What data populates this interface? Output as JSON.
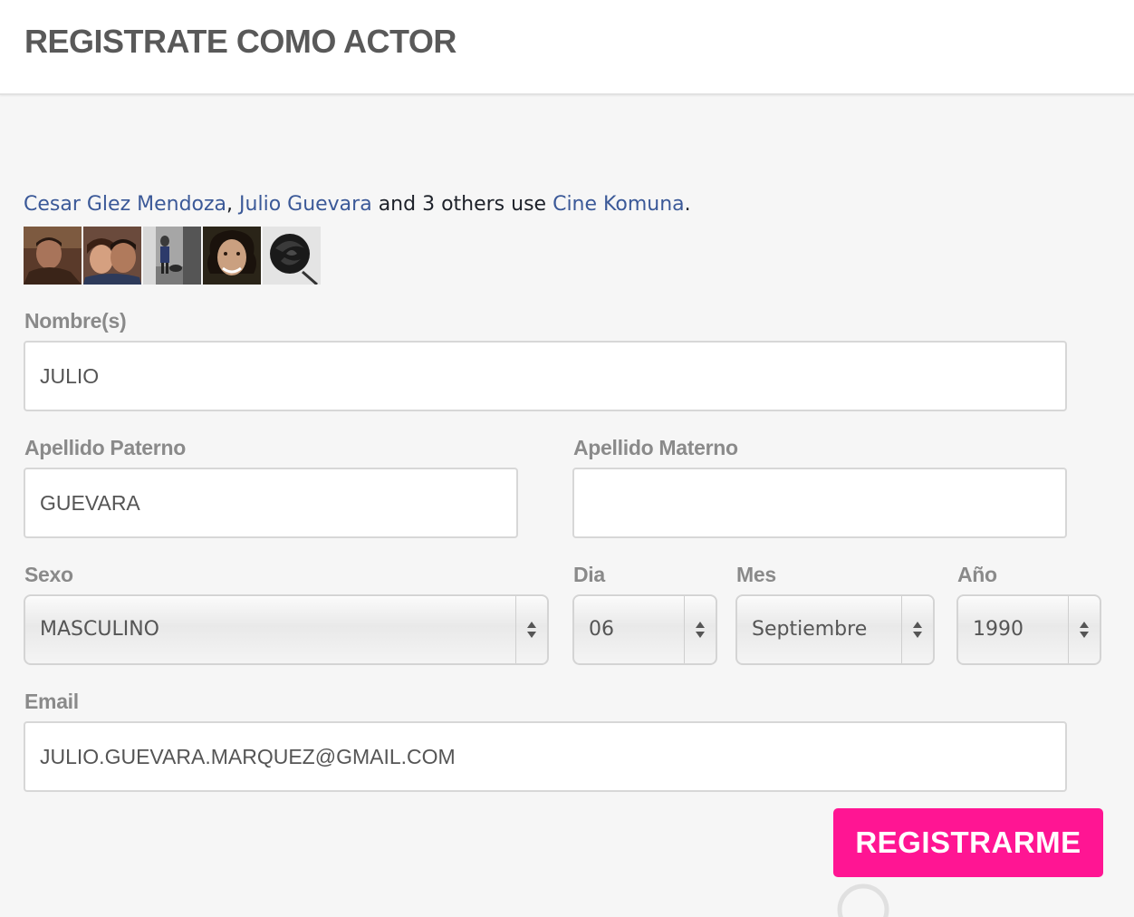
{
  "header": {
    "title": "REGISTRATE COMO ACTOR"
  },
  "social": {
    "friend1": "Cesar Glez Mendoza",
    "separator": ", ",
    "friend2": "Julio Guevara",
    "middle_text": " and 3 others use ",
    "app_name": "Cine Komuna",
    "end_text": "."
  },
  "form": {
    "nombre": {
      "label": "Nombre(s)",
      "value": "JULIO"
    },
    "apellido_paterno": {
      "label": "Apellido Paterno",
      "value": "GUEVARA"
    },
    "apellido_materno": {
      "label": "Apellido Materno",
      "value": ""
    },
    "sexo": {
      "label": "Sexo",
      "value": "MASCULINO"
    },
    "dia": {
      "label": "Dia",
      "value": "06"
    },
    "mes": {
      "label": "Mes",
      "value": "Septiembre"
    },
    "anio": {
      "label": "Año",
      "value": "1990"
    },
    "email": {
      "label": "Email",
      "value": "JULIO.GUEVARA.MARQUEZ@GMAIL.COM"
    }
  },
  "submit_label": "REGISTRARME",
  "colors": {
    "accent": "#ff1593",
    "link": "#3b5998",
    "label": "#8a8a8a",
    "title": "#595959"
  }
}
